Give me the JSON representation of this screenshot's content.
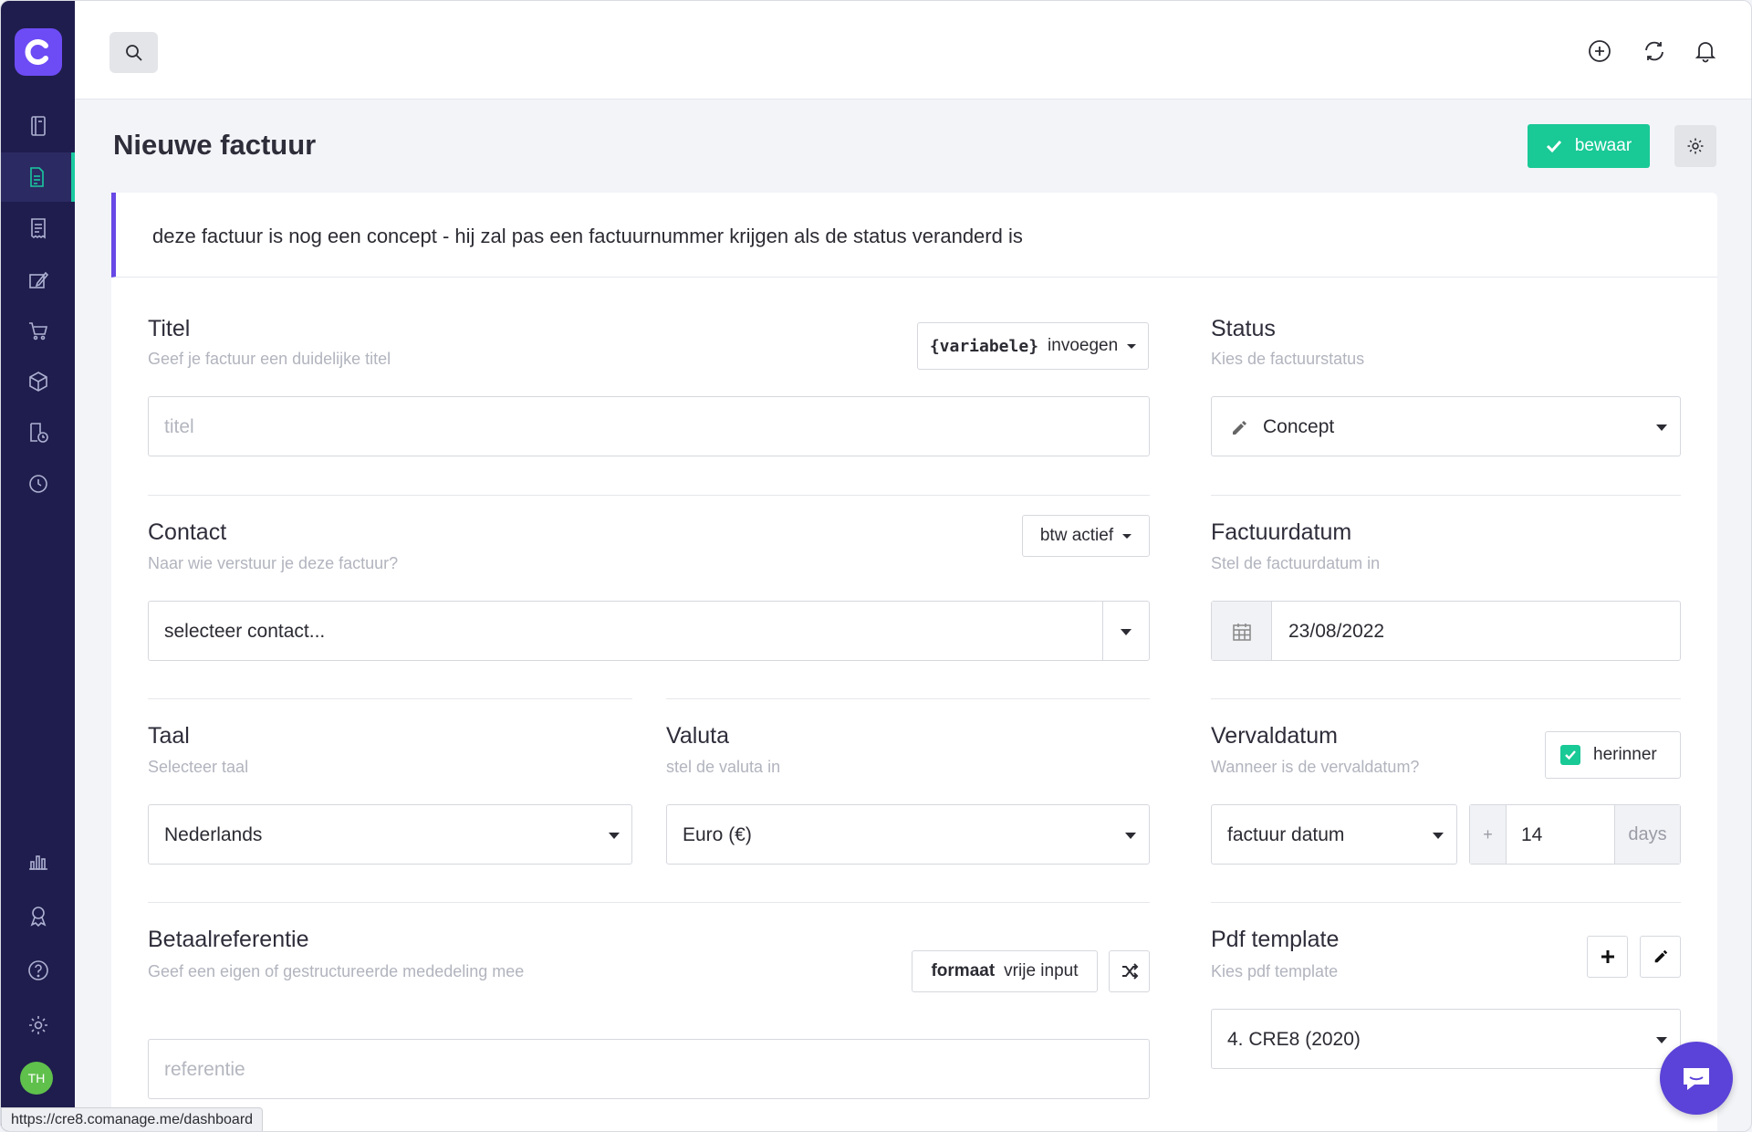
{
  "user": {
    "initials": "TH"
  },
  "page": {
    "title": "Nieuwe factuur",
    "save_label": "bewaar"
  },
  "notice": "deze factuur is nog een concept - hij zal pas een factuurnummer krijgen als de status veranderd is",
  "titel": {
    "label": "Titel",
    "hint": "Geef je factuur een duidelijke titel",
    "placeholder": "titel",
    "var_token": "{variabele}",
    "var_action": "invoegen"
  },
  "status": {
    "label": "Status",
    "hint": "Kies de factuurstatus",
    "value": "Concept"
  },
  "contact": {
    "label": "Contact",
    "hint": "Naar wie verstuur je deze factuur?",
    "placeholder": "selecteer contact...",
    "btw_label": "btw actief"
  },
  "factuurdatum": {
    "label": "Factuurdatum",
    "hint": "Stel de factuurdatum in",
    "value": "23/08/2022"
  },
  "taal": {
    "label": "Taal",
    "hint": "Selecteer taal",
    "value": "Nederlands"
  },
  "valuta": {
    "label": "Valuta",
    "hint": "stel de valuta in",
    "value": "Euro (€)"
  },
  "vervaldatum": {
    "label": "Vervaldatum",
    "hint": "Wanneer is de vervaldatum?",
    "reminder_label": "herinner",
    "reminder_checked": true,
    "base": "factuur datum",
    "plus": "+",
    "days_value": "14",
    "days_unit": "days"
  },
  "betaal": {
    "label": "Betaalreferentie",
    "hint": "Geef een eigen of gestructureerde mededeling mee",
    "format_key": "formaat",
    "format_value": "vrije input",
    "placeholder": "referentie"
  },
  "pdf": {
    "label": "Pdf template",
    "hint": "Kies pdf template",
    "value": "4. CRE8 (2020)"
  },
  "statusbar_url": "https://cre8.comanage.me/dashboard",
  "colors": {
    "sidebar": "#1f1d4d",
    "brand": "#6d4cf5",
    "accent": "#19c996",
    "notice_border": "#6848e6",
    "chat": "#5b42d8"
  }
}
